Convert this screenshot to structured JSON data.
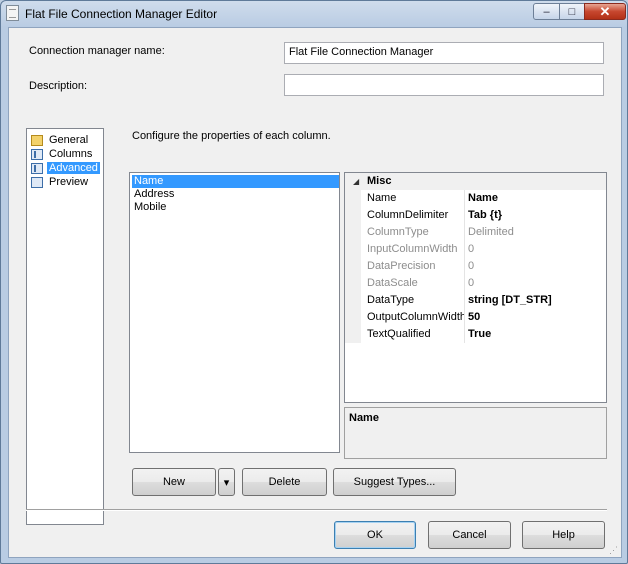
{
  "window": {
    "title": "Flat File Connection Manager Editor",
    "buttons": {
      "minimize": "–",
      "maximize": "□",
      "close": "✕"
    }
  },
  "form": {
    "name_label": "Connection manager name:",
    "name_value": "Flat File Connection Manager",
    "description_label": "Description:",
    "description_value": ""
  },
  "nav": {
    "items": [
      {
        "label": "General",
        "icon": "general-icon"
      },
      {
        "label": "Columns",
        "icon": "columns-icon"
      },
      {
        "label": "Advanced",
        "icon": "advanced-icon",
        "selected": true
      },
      {
        "label": "Preview",
        "icon": "preview-icon"
      }
    ]
  },
  "content": {
    "instruction": "Configure the properties of each column."
  },
  "columns": {
    "items": [
      "Name",
      "Address",
      "Mobile"
    ],
    "selected": "Name"
  },
  "property_grid": {
    "category": "Misc",
    "rows": [
      {
        "name": "Name",
        "value": "Name",
        "bold": true
      },
      {
        "name": "ColumnDelimiter",
        "value": "Tab {t}",
        "bold": true
      },
      {
        "name": "ColumnType",
        "value": "Delimited",
        "disabled": true
      },
      {
        "name": "InputColumnWidth",
        "value": "0",
        "disabled": true
      },
      {
        "name": "DataPrecision",
        "value": "0",
        "disabled": true
      },
      {
        "name": "DataScale",
        "value": "0",
        "disabled": true
      },
      {
        "name": "DataType",
        "value": "string [DT_STR]",
        "bold": true
      },
      {
        "name": "OutputColumnWidth",
        "value": "50",
        "bold": true
      },
      {
        "name": "TextQualified",
        "value": "True",
        "bold": true
      }
    ]
  },
  "description_panel": {
    "title": "Name"
  },
  "column_buttons": {
    "new": "New",
    "new_dropdown": "▾",
    "delete": "Delete",
    "suggest": "Suggest Types..."
  },
  "dialog_buttons": {
    "ok": "OK",
    "cancel": "Cancel",
    "help": "Help"
  }
}
